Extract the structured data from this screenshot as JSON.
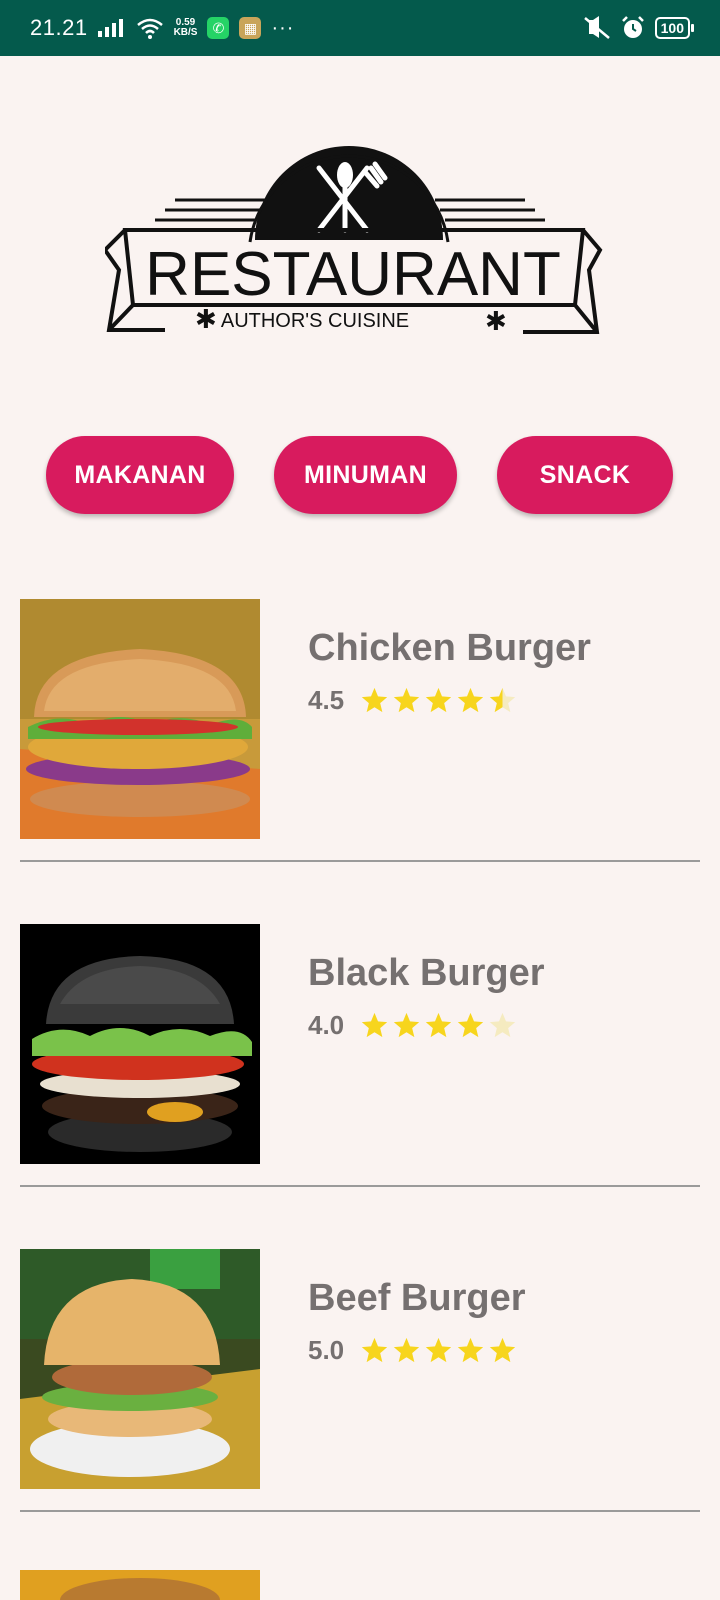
{
  "status_bar": {
    "time": "21.21",
    "speed_value": "0.59",
    "speed_unit": "KB/S",
    "more": "···",
    "battery": "100"
  },
  "logo": {
    "title": "RESTAURANT",
    "subtitle": "AUTHOR'S CUISINE"
  },
  "tabs": [
    {
      "label": "MAKANAN"
    },
    {
      "label": "MINUMAN"
    },
    {
      "label": "SNACK"
    }
  ],
  "menu_items": [
    {
      "name": "Chicken Burger",
      "rating": "4.5",
      "stars": 4.5
    },
    {
      "name": "Black Burger",
      "rating": "4.0",
      "stars": 4.0
    },
    {
      "name": "Beef Burger",
      "rating": "5.0",
      "stars": 5.0
    }
  ],
  "colors": {
    "status_bar": "#045a4c",
    "background": "#faf3f1",
    "tab": "#d81b5e",
    "star": "#f7d51d",
    "text": "#757070"
  }
}
